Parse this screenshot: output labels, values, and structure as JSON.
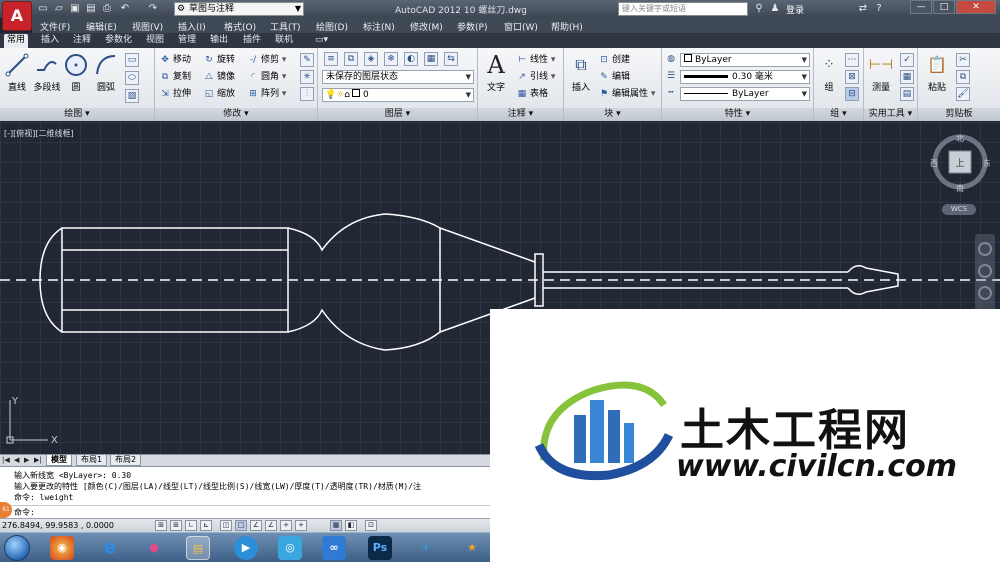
{
  "app": {
    "logo_letter": "A",
    "workspace": "草图与注释",
    "title": "AutoCAD 2012    10 螺丝刀.dwg",
    "search_placeholder": "键入关键字或短语",
    "login": "登录",
    "window_buttons": [
      "—",
      "□",
      "✕"
    ]
  },
  "menu": [
    "文件(F)",
    "编辑(E)",
    "视图(V)",
    "插入(I)",
    "格式(O)",
    "工具(T)",
    "绘图(D)",
    "标注(N)",
    "修改(M)",
    "参数(P)",
    "窗口(W)",
    "帮助(H)"
  ],
  "ribbon_tabs": [
    "常用",
    "插入",
    "注释",
    "参数化",
    "视图",
    "管理",
    "输出",
    "插件",
    "联机",
    "▭▾"
  ],
  "ribbon": {
    "draw": {
      "title": "绘图 ▾",
      "line": "直线",
      "polyline": "多段线",
      "circle": "圆",
      "arc": "圆弧"
    },
    "modify": {
      "title": "修改 ▾",
      "move": "移动",
      "rotate": "旋转",
      "trim": "修剪",
      "copy": "复制",
      "mirror": "镜像",
      "fillet": "圆角",
      "stretch": "拉伸",
      "scale": "缩放",
      "array": "阵列"
    },
    "layers": {
      "title": "图层 ▾",
      "layer_state": "未保存的图层状态",
      "current_layer": "0"
    },
    "annotation": {
      "title": "注释 ▾",
      "text": "文字",
      "linear": "线性",
      "leader": "引线",
      "table": "表格"
    },
    "block": {
      "title": "块 ▾",
      "insert": "插入",
      "create": "创建",
      "edit": "编辑",
      "edit_attributes": "编辑属性"
    },
    "properties": {
      "title": "特性 ▾",
      "color": "ByLayer",
      "lineweight": "0.30 毫米",
      "linetype": "ByLayer"
    },
    "groups": {
      "title": "组 ▾",
      "group": "组"
    },
    "utilities": {
      "title": "实用工具 ▾",
      "measure": "测量"
    },
    "clipboard": {
      "title": "剪贴板",
      "paste": "粘贴"
    }
  },
  "viewport": {
    "label": "[-][俯视][二维线框]",
    "viewcube": {
      "north": "北",
      "south": "南",
      "east": "东",
      "west": "西",
      "face": "上",
      "wcs": "WCS"
    },
    "ucs": {
      "x": "X",
      "y": "Y"
    }
  },
  "layout_tabs": [
    "模型",
    "布局1",
    "布局2"
  ],
  "layout_nav": [
    "|◀",
    "◀",
    "▶",
    "▶|"
  ],
  "command": {
    "lines": [
      "输入新线宽 <ByLayer>: 0.30",
      "输入要更改的特性 [颜色(C)/图层(LA)/线型(LT)/线型比例(S)/线宽(LW)/厚度(T)/透明度(TR)/材质(M)/注",
      "命令: lweight"
    ],
    "prompt": "命令:",
    "badge": "61"
  },
  "status": {
    "coords": "276.8494, 99.9583 , 0.0000",
    "toggles": [
      "⊞",
      "⊞",
      "∟",
      "⊾",
      "◫",
      "□",
      "∠",
      "∠",
      "+",
      "+",
      "▦",
      "◧",
      "⊡"
    ]
  },
  "taskbar": {
    "icons": [
      "◉",
      "e",
      "●",
      "▤",
      "▶",
      "◎",
      "∞",
      "Ps",
      "✈",
      "★"
    ]
  },
  "watermark": {
    "title": "土木工程网",
    "url": "www.civilcn.com"
  }
}
